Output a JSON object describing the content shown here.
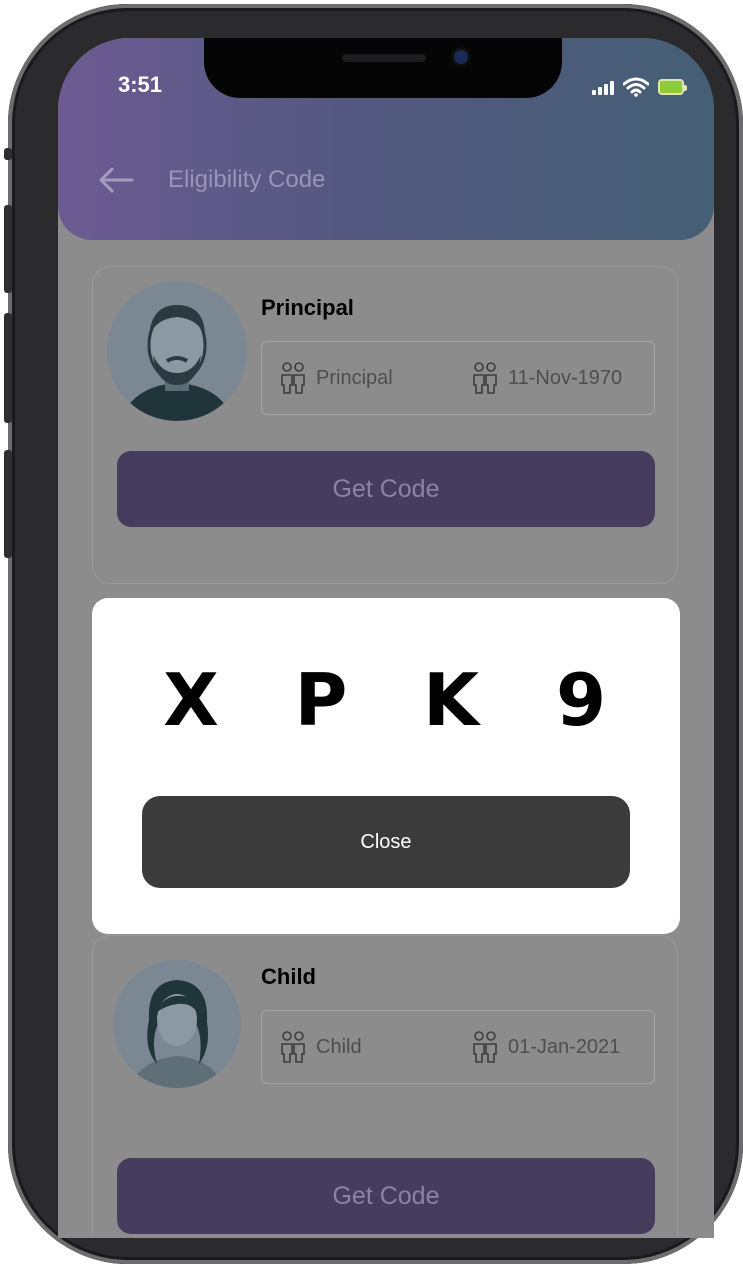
{
  "status_bar": {
    "time": "3:51"
  },
  "header": {
    "title": "Eligibility Code"
  },
  "members": [
    {
      "name": "Principal",
      "relation": "Principal",
      "dob": "11-Nov-1970",
      "button_label": "Get Code",
      "avatar_icon": "man-avatar-icon"
    },
    {
      "name": "Child",
      "relation": "Child",
      "dob": "01-Jan-2021",
      "button_label": "Get Code",
      "avatar_icon": "woman-avatar-icon"
    }
  ],
  "code_modal": {
    "chars": [
      "X",
      "P",
      "K",
      "9"
    ],
    "close_label": "Close"
  },
  "colors": {
    "header_start": "#6c5b92",
    "header_end": "#455f75",
    "button_bg": "#463d5e",
    "overlay": "#8c8c8c",
    "close_button": "#3b3b3b"
  }
}
